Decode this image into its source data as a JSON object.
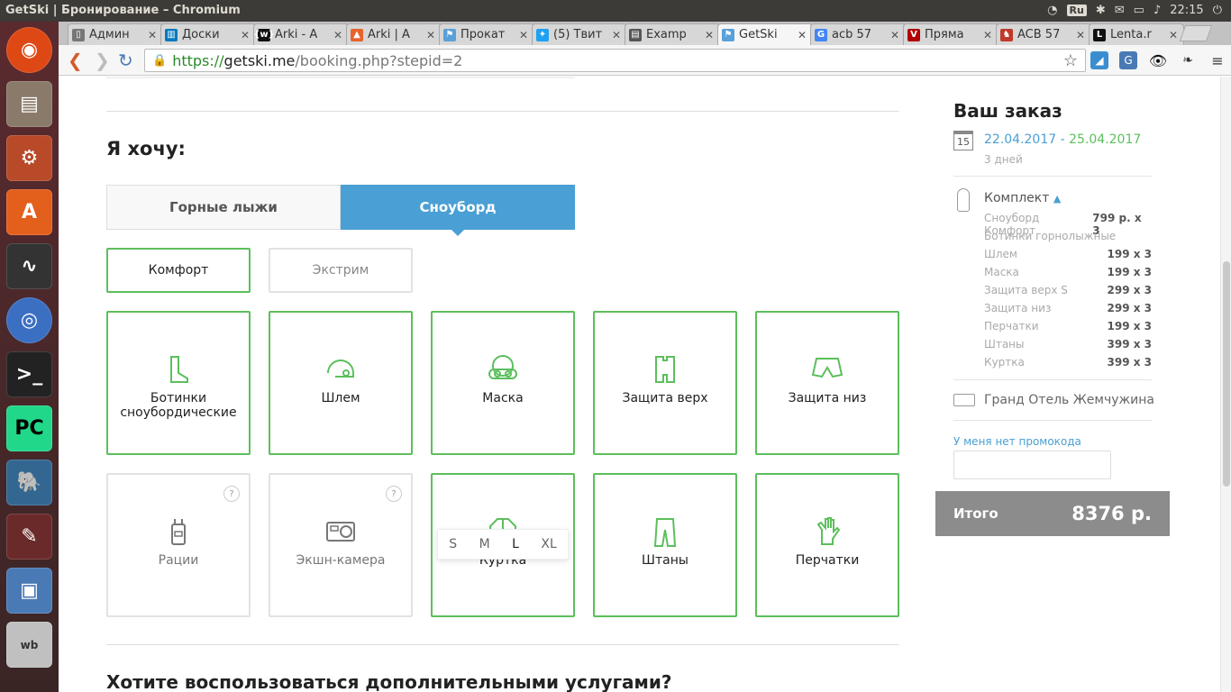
{
  "window": {
    "title": "GetSki | Бронирование – Chromium",
    "lang": "Ru",
    "clock": "22:15"
  },
  "tabs": [
    {
      "label": "Админ",
      "color": "#777",
      "glyph": "▯"
    },
    {
      "label": "Доски",
      "color": "#0079bf",
      "glyph": "▥"
    },
    {
      "label": "Arki - A",
      "color": "#111",
      "glyph": "{w}"
    },
    {
      "label": "Arki | A",
      "color": "#e8622c",
      "glyph": "▲"
    },
    {
      "label": "Прокат",
      "color": "#5aa0d8",
      "glyph": "⚑"
    },
    {
      "label": "(5) Твит",
      "color": "#1da1f2",
      "glyph": "✦"
    },
    {
      "label": "Examp",
      "color": "#555",
      "glyph": "▤"
    },
    {
      "label": "GetSki",
      "color": "#5aa0d8",
      "glyph": "⚑",
      "active": true
    },
    {
      "label": "acb 57",
      "color": "#4285f4",
      "glyph": "G"
    },
    {
      "label": "Пряма",
      "color": "#b30000",
      "glyph": "V"
    },
    {
      "label": "ACB 57",
      "color": "#c0392b",
      "glyph": "♞"
    },
    {
      "label": "Lenta.r",
      "color": "#111",
      "glyph": "L"
    }
  ],
  "url": {
    "scheme": "https://",
    "host": "getski.me",
    "path": "/booking.php?stepid=2"
  },
  "main": {
    "want_title": "Я хочу:",
    "tab_ski": "Горные лыжи",
    "tab_snowboard": "Сноуборд",
    "level_comfort": "Комфорт",
    "level_extreme": "Экстрим",
    "cards": [
      {
        "label": "Ботинки сноубордические",
        "icon": "boot-icon",
        "active": true
      },
      {
        "label": "Шлем",
        "icon": "helmet-icon",
        "active": true
      },
      {
        "label": "Маска",
        "icon": "goggles-icon",
        "active": true
      },
      {
        "label": "Защита верх",
        "icon": "upper-protection-icon",
        "active": true
      },
      {
        "label": "Защита низ",
        "icon": "lower-protection-icon",
        "active": true
      },
      {
        "label": "Рации",
        "icon": "walkie-talkie-icon",
        "active": false,
        "help": "?"
      },
      {
        "label": "Экшн-камера",
        "icon": "action-camera-icon",
        "active": false,
        "help": "?"
      },
      {
        "label": "Куртка",
        "icon": "jacket-icon",
        "active": true
      },
      {
        "label": "Штаны",
        "icon": "pants-icon",
        "active": true
      },
      {
        "label": "Перчатки",
        "icon": "gloves-icon",
        "active": true
      }
    ],
    "sizes": [
      "S",
      "M",
      "L",
      "XL"
    ],
    "selected_size": "L",
    "extra_title": "Хотите воспользоваться дополнительными услугами?"
  },
  "order": {
    "title": "Ваш заказ",
    "calendar_day": "15",
    "date_from": "22.04.2017",
    "date_sep": " - ",
    "date_to": "25.04.2017",
    "days": "3 дней",
    "kit_label": "Комплект",
    "items": [
      {
        "name": "Сноуборд Комфорт",
        "price": "799 р. x 3"
      },
      {
        "name": "Ботинки горнолыжные",
        "price": ""
      },
      {
        "name": "Шлем",
        "price": "199 x 3"
      },
      {
        "name": "Маска",
        "price": "199 x 3"
      },
      {
        "name": "Защита верх S",
        "price": "299 x 3"
      },
      {
        "name": "Защита низ",
        "price": "299 x 3"
      },
      {
        "name": "Перчатки",
        "price": "199 x 3"
      },
      {
        "name": "Штаны",
        "price": "399 x 3"
      },
      {
        "name": "Куртка",
        "price": "399 x 3"
      }
    ],
    "hotel": "Гранд Отель Жемчужина",
    "promo_link": "У меня нет промокода",
    "promo_value": "",
    "total_label": "Итого",
    "total_value": "8376 р."
  },
  "colors": {
    "accent": "#4a9fd4",
    "green": "#5cbf5c",
    "date_from": "#4a9fd4",
    "date_to": "#5cbf5c"
  }
}
